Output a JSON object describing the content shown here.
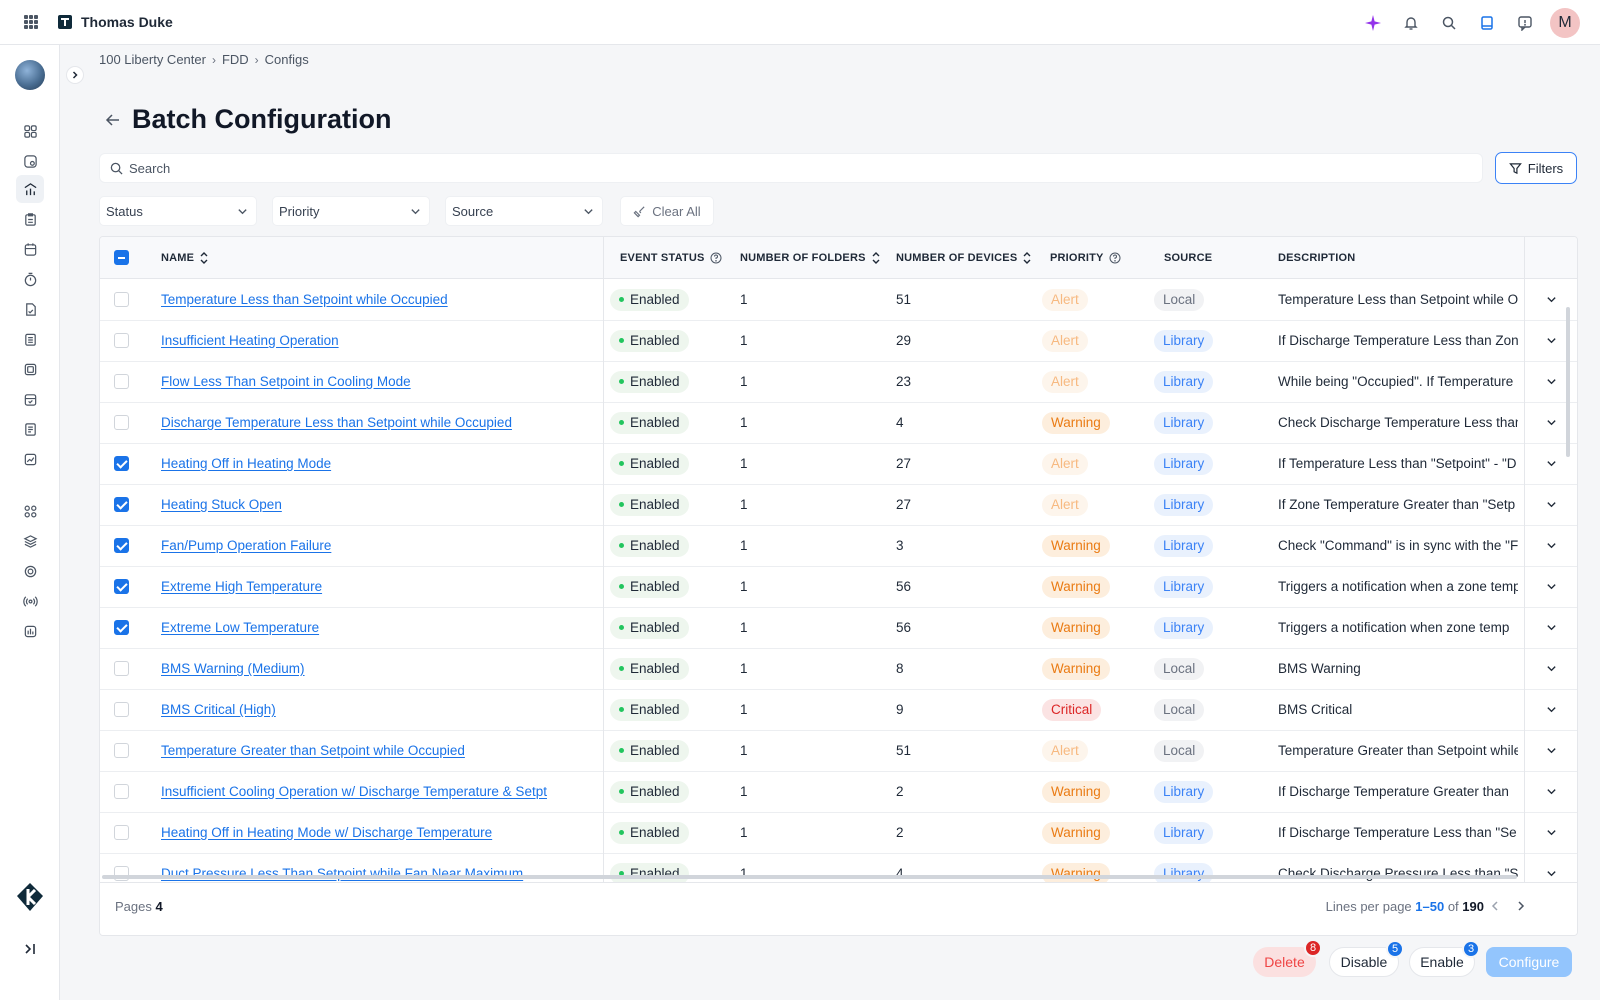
{
  "app": {
    "title": "Thomas Duke",
    "avatar_initial": "M"
  },
  "header_icons": [
    "sparkle-icon",
    "bell-icon",
    "search-icon",
    "book-icon",
    "help-chat-icon"
  ],
  "sidebar": {
    "icons": [
      "dashboard-icon",
      "monitor-icon",
      "analytics-icon",
      "clipboard-icon",
      "calendar-icon",
      "timer-icon",
      "document-icon",
      "checklist-icon",
      "archive-icon",
      "schedule-icon",
      "report-icon",
      "chart-icon",
      "integrations-icon",
      "layers-icon",
      "settings-icon",
      "broadcast-icon",
      "meter-icon"
    ]
  },
  "breadcrumb": [
    "100 Liberty Center",
    "FDD",
    "Configs"
  ],
  "page": {
    "title": "Batch Configuration"
  },
  "search": {
    "placeholder": "Search",
    "value": ""
  },
  "filters": {
    "button_label": "Filters",
    "status": "Status",
    "priority": "Priority",
    "source": "Source",
    "clear_all": "Clear All"
  },
  "table": {
    "columns": {
      "name": "NAME",
      "event_status": "EVENT STATUS",
      "folders": "NUMBER OF FOLDERS",
      "devices": "NUMBER OF DEVICES",
      "priority": "PRIORITY",
      "source": "SOURCE",
      "description": "DESCRIPTION"
    },
    "rows": [
      {
        "checked": false,
        "name": "Temperature Less than Setpoint while Occupied",
        "status": "Enabled",
        "folders": "1",
        "devices": "51",
        "priority": "Alert",
        "source": "Local",
        "description": "Temperature Less than Setpoint while Occupied"
      },
      {
        "checked": false,
        "name": "Insufficient Heating Operation",
        "status": "Enabled",
        "folders": "1",
        "devices": "29",
        "priority": "Alert",
        "source": "Library",
        "description": "If Discharge Temperature Less than Zone"
      },
      {
        "checked": false,
        "name": "Flow Less Than Setpoint in Cooling Mode",
        "status": "Enabled",
        "folders": "1",
        "devices": "23",
        "priority": "Alert",
        "source": "Library",
        "description": "While being \"Occupied\". If Temperature"
      },
      {
        "checked": false,
        "name": "Discharge Temperature Less than Setpoint while Occupied",
        "status": "Enabled",
        "folders": "1",
        "devices": "4",
        "priority": "Warning",
        "source": "Library",
        "description": "Check Discharge Temperature Less than"
      },
      {
        "checked": true,
        "name": "Heating Off in Heating Mode",
        "status": "Enabled",
        "folders": "1",
        "devices": "27",
        "priority": "Alert",
        "source": "Library",
        "description": "If Temperature Less than \"Setpoint\" - \"D"
      },
      {
        "checked": true,
        "name": "Heating Stuck Open",
        "status": "Enabled",
        "folders": "1",
        "devices": "27",
        "priority": "Alert",
        "source": "Library",
        "description": "If Zone Temperature Greater than \"Setp"
      },
      {
        "checked": true,
        "name": "Fan/Pump Operation Failure",
        "status": "Enabled",
        "folders": "1",
        "devices": "3",
        "priority": "Warning",
        "source": "Library",
        "description": "Check \"Command\" is in sync with the \"F"
      },
      {
        "checked": true,
        "name": "Extreme High Temperature",
        "status": "Enabled",
        "folders": "1",
        "devices": "56",
        "priority": "Warning",
        "source": "Library",
        "description": "Triggers a notification when a zone temp"
      },
      {
        "checked": true,
        "name": "Extreme Low Temperature",
        "status": "Enabled",
        "folders": "1",
        "devices": "56",
        "priority": "Warning",
        "source": "Library",
        "description": "Triggers a notification when zone temp"
      },
      {
        "checked": false,
        "name": "BMS Warning (Medium)",
        "status": "Enabled",
        "folders": "1",
        "devices": "8",
        "priority": "Warning",
        "source": "Local",
        "description": "BMS Warning"
      },
      {
        "checked": false,
        "name": "BMS Critical (High)",
        "status": "Enabled",
        "folders": "1",
        "devices": "9",
        "priority": "Critical",
        "source": "Local",
        "description": "BMS Critical"
      },
      {
        "checked": false,
        "name": "Temperature Greater than Setpoint while Occupied",
        "status": "Enabled",
        "folders": "1",
        "devices": "51",
        "priority": "Alert",
        "source": "Local",
        "description": "Temperature Greater than Setpoint while"
      },
      {
        "checked": false,
        "name": "Insufficient Cooling Operation w/ Discharge Temperature & Setpt",
        "status": "Enabled",
        "folders": "1",
        "devices": "2",
        "priority": "Warning",
        "source": "Library",
        "description": "If Discharge Temperature Greater than"
      },
      {
        "checked": false,
        "name": "Heating Off in Heating Mode w/ Discharge Temperature",
        "status": "Enabled",
        "folders": "1",
        "devices": "2",
        "priority": "Warning",
        "source": "Library",
        "description": "If Discharge Temperature Less than \"Se"
      },
      {
        "checked": false,
        "name": "Duct Pressure Less Than Setpoint while Fan Near Maximum",
        "status": "Enabled",
        "folders": "1",
        "devices": "4",
        "priority": "Warning",
        "source": "Library",
        "description": "Check Discharge Pressure Less than \"S"
      }
    ]
  },
  "pagination": {
    "pages_label": "Pages",
    "pages_count": "4",
    "lines_label": "Lines per page",
    "range": "1–50",
    "of_label": "of",
    "total": "190"
  },
  "actions": {
    "delete": {
      "label": "Delete",
      "count": "8"
    },
    "disable": {
      "label": "Disable",
      "count": "5"
    },
    "enable": {
      "label": "Enable",
      "count": "3"
    },
    "configure": {
      "label": "Configure"
    }
  },
  "colors": {
    "accent": "#1a73e8",
    "warning": "#ea7b13",
    "alert": "#f7b980",
    "critical": "#dc2626"
  }
}
